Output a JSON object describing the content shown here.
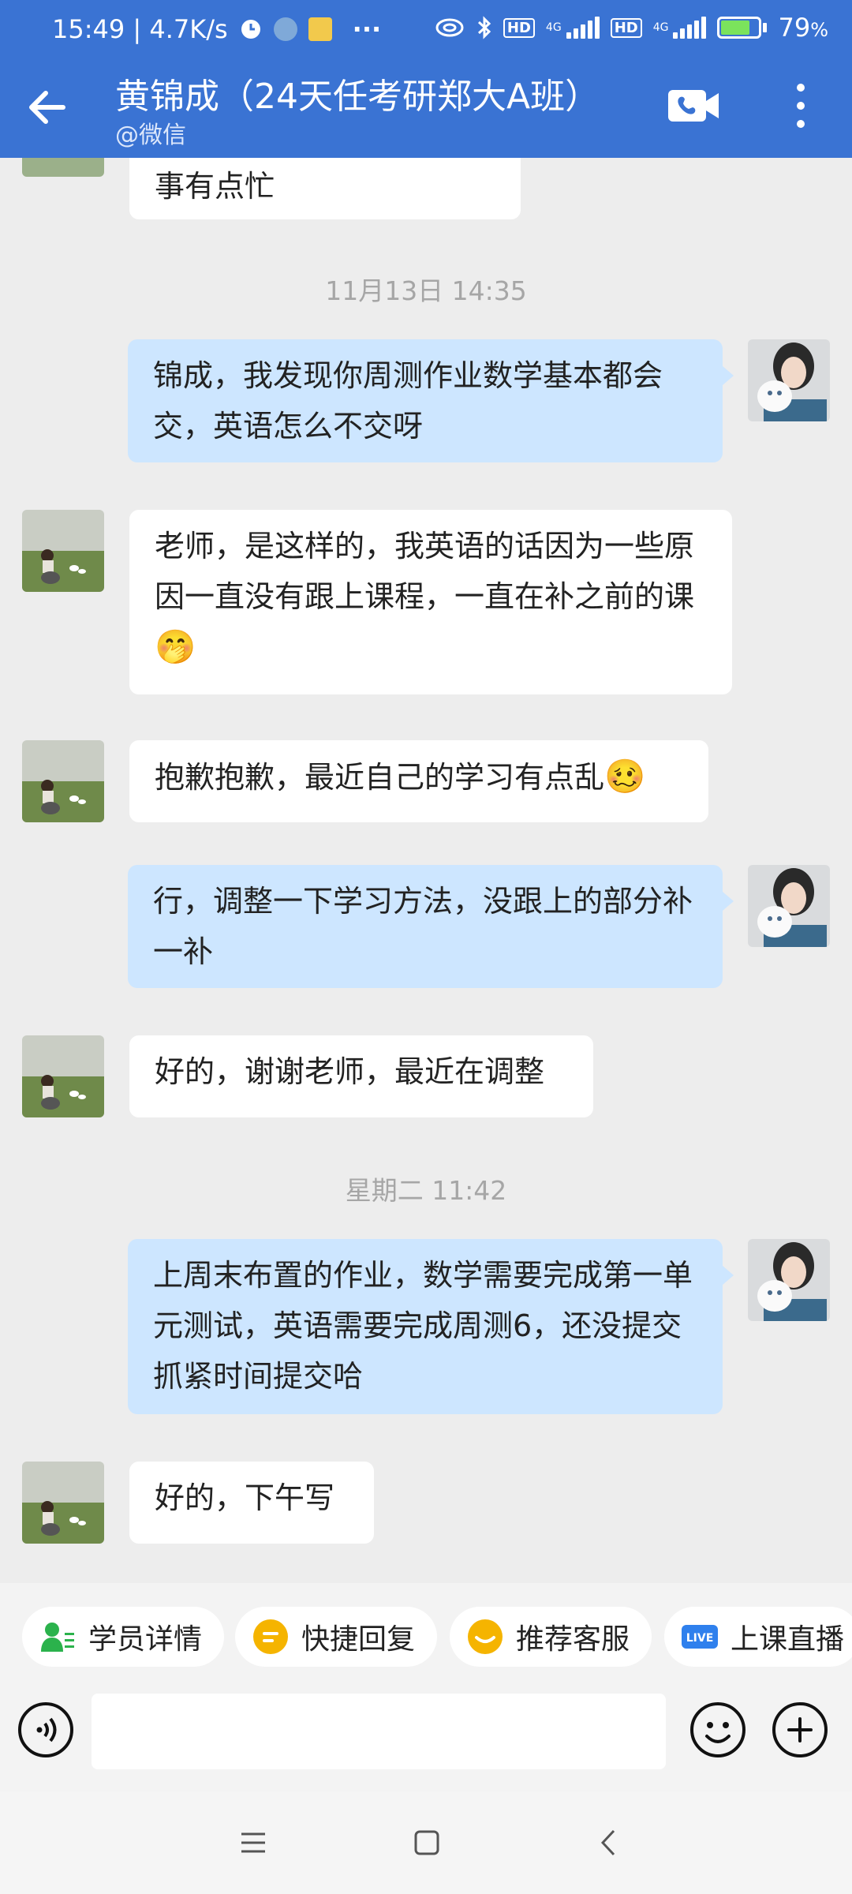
{
  "status_bar": {
    "time_speed": "15:49 | 4.7K/s",
    "network": "4G",
    "hd": "HD",
    "battery": "79",
    "battery_unit": "%",
    "battery_level": 0.79,
    "more_dots": "···"
  },
  "header": {
    "title": "黄锦成（24天任考研郑大A班）",
    "subtitle": "@微信"
  },
  "messages": [
    {
      "id": "m0",
      "from": "contact",
      "text": "事有点忙"
    },
    {
      "id": "ts1",
      "type": "timestamp",
      "text": "11月13日  14:35"
    },
    {
      "id": "m1",
      "from": "me",
      "text": "锦成，我发现你周测作业数学基本都会交，英语怎么不交呀"
    },
    {
      "id": "m2",
      "from": "contact",
      "text": "老师，是这样的，我英语的话因为一些原因一直没有跟上课程，一直在补之前的课",
      "emoji": "🤭"
    },
    {
      "id": "m3",
      "from": "contact",
      "text": "抱歉抱歉，最近自己的学习有点乱",
      "emoji": "🥴"
    },
    {
      "id": "m4",
      "from": "me",
      "text": "行，调整一下学习方法，没跟上的部分补一补"
    },
    {
      "id": "m5",
      "from": "contact",
      "text": "好的，谢谢老师，最近在调整"
    },
    {
      "id": "ts2",
      "type": "timestamp",
      "text": "星期二  11:42"
    },
    {
      "id": "m6",
      "from": "me",
      "text": "上周末布置的作业，数学需要完成第一单元测试，英语需要完成周测6，还没提交抓紧时间提交哈"
    },
    {
      "id": "m7",
      "from": "contact",
      "text": "好的，下午写"
    }
  ],
  "quick_actions": [
    {
      "label": "学员详情",
      "icon": "student-info-icon",
      "color": "#2bb24c"
    },
    {
      "label": "快捷回复",
      "icon": "quick-reply-icon",
      "color": "#f5b400"
    },
    {
      "label": "推荐客服",
      "icon": "service-icon",
      "color": "#f5b400"
    },
    {
      "label": "上课直播",
      "icon": "live-icon",
      "color": "#2f80ed",
      "badge": "LIVE"
    }
  ],
  "input": {
    "value": "",
    "placeholder": ""
  },
  "colors": {
    "brand": "#3a73d3",
    "outgoing_bubble": "#cde6ff",
    "incoming_bubble": "#ffffff",
    "background": "#ededed"
  }
}
